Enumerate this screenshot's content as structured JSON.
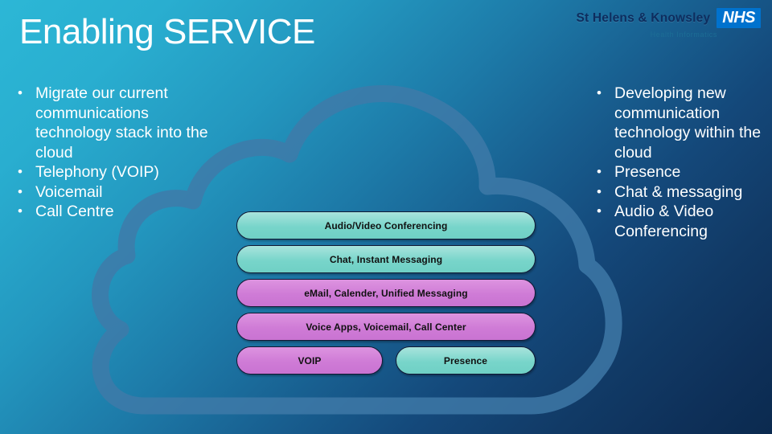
{
  "slide": {
    "title": "Enabling SERVICE",
    "background_top_color": "#2cb7d6",
    "background_bottom_color": "#0b2a4f"
  },
  "logo": {
    "trust_name": "St Helens & Knowsley",
    "nhs_mark": "NHS",
    "sub_label": "Health Informatics",
    "nhs_blue": "#0072ce"
  },
  "bullets_left": [
    {
      "bullet": "•",
      "text": "Migrate our current communications technology stack into the cloud"
    },
    {
      "bullet": "•",
      "text": "Telephony (VOIP)"
    },
    {
      "bullet": "•",
      "text": "Voicemail"
    },
    {
      "bullet": "•",
      "text": "Call Centre"
    }
  ],
  "bullets_right": [
    {
      "bullet": "•",
      "text": "Developing new communication technology within the cloud"
    },
    {
      "bullet": "•",
      "text": "Presence"
    },
    {
      "bullet": "•",
      "text": "Chat & messaging"
    },
    {
      "bullet": "•",
      "text": "Audio & Video Conferencing"
    }
  ],
  "cloud": {
    "stroke_color": "#3f7aa8",
    "stroke_width": 21
  },
  "pill_rows": [
    {
      "items": [
        {
          "label": "Audio/Video Conferencing",
          "color": "teal",
          "width": "full"
        }
      ]
    },
    {
      "items": [
        {
          "label": "Chat, Instant Messaging",
          "color": "teal",
          "width": "full"
        }
      ]
    },
    {
      "items": [
        {
          "label": "eMail, Calender, Unified Messaging",
          "color": "purple",
          "width": "full"
        }
      ]
    },
    {
      "items": [
        {
          "label": "Voice Apps, Voicemail, Call Center",
          "color": "purple",
          "width": "full"
        }
      ]
    },
    {
      "items": [
        {
          "label": "VOIP",
          "color": "purple",
          "width": "half-left"
        },
        {
          "label": "Presence",
          "color": "teal",
          "width": "half-right"
        }
      ]
    }
  ],
  "pill_colors": {
    "teal": "#78d5ca",
    "purple": "#cf7bd6",
    "border": "#111833"
  }
}
